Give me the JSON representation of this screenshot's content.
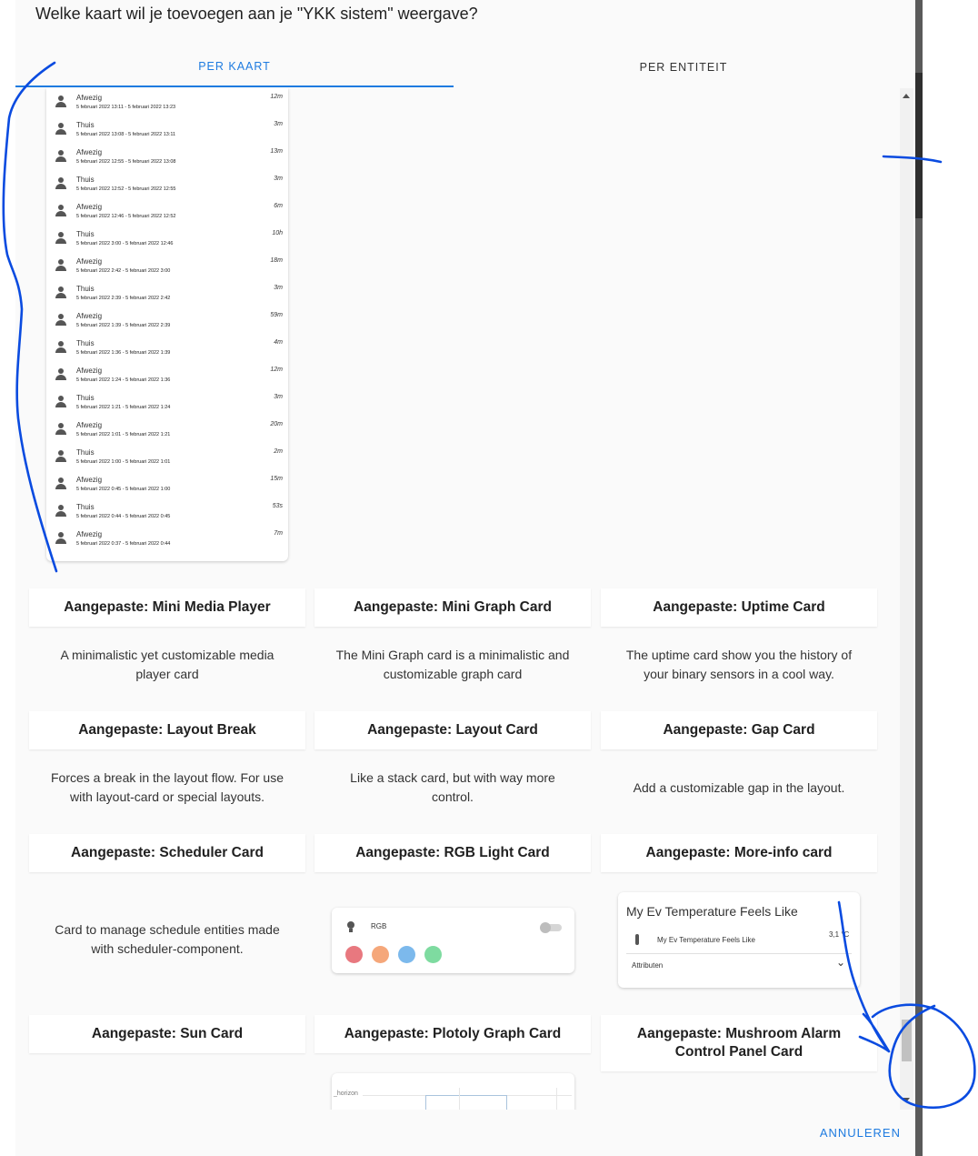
{
  "dialog": {
    "title": "Welke kaart wil je toevoegen aan je \"YKK sistem\" weergave?",
    "cancel_label": "ANNULEREN"
  },
  "tabs": [
    {
      "label": "PER KAART",
      "active": true
    },
    {
      "label": "PER ENTITEIT",
      "active": false
    }
  ],
  "history": [
    {
      "state": "Afwezig",
      "range": "5 februari 2022 13:11 - 5 februari 2022 13:23",
      "duration": "12m"
    },
    {
      "state": "Thuis",
      "range": "5 februari 2022 13:08 - 5 februari 2022 13:11",
      "duration": "3m"
    },
    {
      "state": "Afwezig",
      "range": "5 februari 2022 12:55 - 5 februari 2022 13:08",
      "duration": "13m"
    },
    {
      "state": "Thuis",
      "range": "5 februari 2022 12:52 - 5 februari 2022 12:55",
      "duration": "3m"
    },
    {
      "state": "Afwezig",
      "range": "5 februari 2022 12:46 - 5 februari 2022 12:52",
      "duration": "6m"
    },
    {
      "state": "Thuis",
      "range": "5 februari 2022 3:00 - 5 februari 2022 12:46",
      "duration": "10h"
    },
    {
      "state": "Afwezig",
      "range": "5 februari 2022 2:42 - 5 februari 2022 3:00",
      "duration": "18m"
    },
    {
      "state": "Thuis",
      "range": "5 februari 2022 2:39 - 5 februari 2022 2:42",
      "duration": "3m"
    },
    {
      "state": "Afwezig",
      "range": "5 februari 2022 1:39 - 5 februari 2022 2:39",
      "duration": "59m"
    },
    {
      "state": "Thuis",
      "range": "5 februari 2022 1:36 - 5 februari 2022 1:39",
      "duration": "4m"
    },
    {
      "state": "Afwezig",
      "range": "5 februari 2022 1:24 - 5 februari 2022 1:36",
      "duration": "12m"
    },
    {
      "state": "Thuis",
      "range": "5 februari 2022 1:21 - 5 februari 2022 1:24",
      "duration": "3m"
    },
    {
      "state": "Afwezig",
      "range": "5 februari 2022 1:01 - 5 februari 2022 1:21",
      "duration": "20m"
    },
    {
      "state": "Thuis",
      "range": "5 februari 2022 1:00 - 5 februari 2022 1:01",
      "duration": "2m"
    },
    {
      "state": "Afwezig",
      "range": "5 februari 2022 0:45 - 5 februari 2022 1:00",
      "duration": "15m"
    },
    {
      "state": "Thuis",
      "range": "5 februari 2022 0:44 - 5 februari 2022 0:45",
      "duration": "53s"
    },
    {
      "state": "Afwezig",
      "range": "5 februari 2022 0:37 - 5 februari 2022 0:44",
      "duration": "7m"
    }
  ],
  "cards": [
    {
      "title": "Aangepaste: Mini Media Player",
      "desc": "A minimalistic yet customizable media player card"
    },
    {
      "title": "Aangepaste: Mini Graph Card",
      "desc": "The Mini Graph card is a minimalistic and customizable graph card"
    },
    {
      "title": "Aangepaste: Uptime Card",
      "desc": "The uptime card show you the history of your binary sensors in a cool way."
    },
    {
      "title": "Aangepaste: Layout Break",
      "desc": "Forces a break in the layout flow. For use with layout-card or special layouts."
    },
    {
      "title": "Aangepaste: Layout Card",
      "desc": "Like a stack card, but with way more control."
    },
    {
      "title": "Aangepaste: Gap Card",
      "desc": "Add a customizable gap in the layout."
    },
    {
      "title": "Aangepaste: Scheduler Card",
      "desc": "Card to manage schedule entities made with scheduler-component."
    },
    {
      "title": "Aangepaste: RGB Light Card",
      "desc": ""
    },
    {
      "title": "Aangepaste: More-info card",
      "desc": ""
    },
    {
      "title": "Aangepaste: Sun Card",
      "desc": ""
    },
    {
      "title": "Aangepaste: Plotoly Graph Card",
      "desc": ""
    },
    {
      "title": "Aangepaste: Mushroom Alarm Control Panel Card",
      "desc": ""
    }
  ],
  "rgb_preview": {
    "label": "RGB",
    "colors": [
      "#e8787f",
      "#f5a77a",
      "#7cb9ec",
      "#7edba0"
    ]
  },
  "more_info_preview": {
    "title": "My Ev Temperature Feels Like",
    "entity": "My Ev Temperature Feels Like",
    "value": "3,1 °C",
    "attributes_label": "Attributen"
  },
  "plotly_preview": {
    "label": "_horizon"
  },
  "colors": {
    "accent": "#1e7be0",
    "annotation_ink": "#0a4be0"
  }
}
